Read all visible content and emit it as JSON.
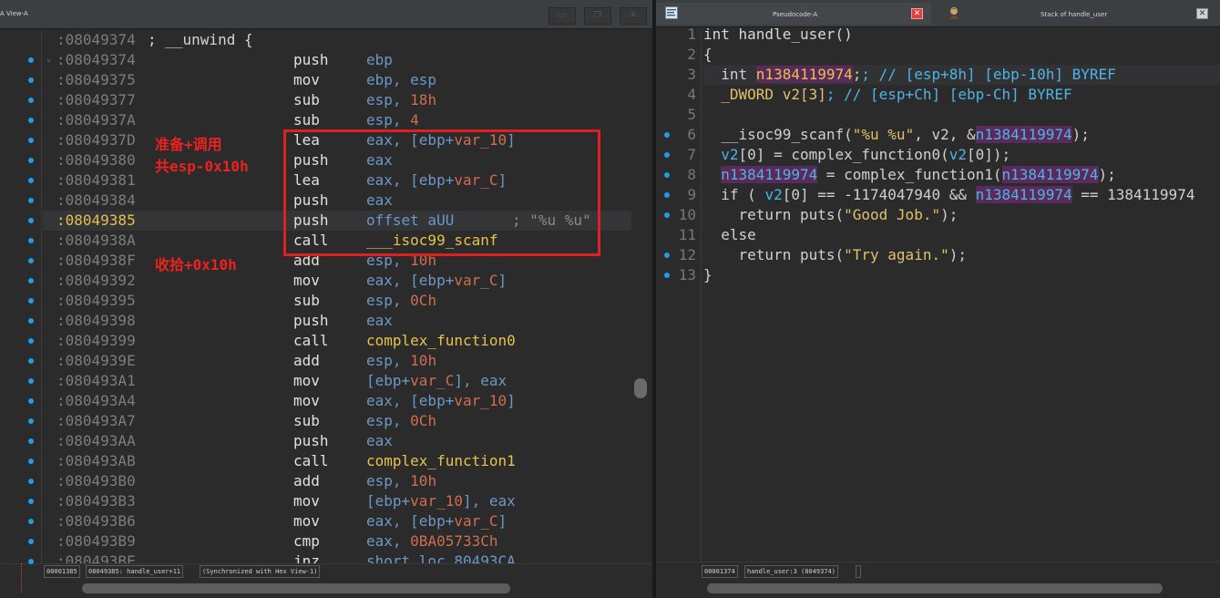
{
  "left": {
    "title": "A View-A",
    "rows": [
      {
        "addr": ":08049374",
        "unwind": "; __unwind {"
      },
      {
        "addr": ":08049374",
        "mnem": "push",
        "ops": "ebp"
      },
      {
        "addr": ":08049375",
        "mnem": "mov",
        "ops": "ebp, esp"
      },
      {
        "addr": ":08049377",
        "mnem": "sub",
        "ops_pre": "esp, ",
        "ops_num": "18h"
      },
      {
        "addr": ":0804937A",
        "mnem": "sub",
        "ops_pre": "esp, ",
        "ops_num": "4"
      },
      {
        "addr": ":0804937D",
        "mnem": "lea",
        "ops_pre": "eax, [ebp+",
        "ops_var": "var_10",
        "ops_post": "]"
      },
      {
        "addr": ":08049380",
        "mnem": "push",
        "ops": "eax"
      },
      {
        "addr": ":08049381",
        "mnem": "lea",
        "ops_pre": "eax, [ebp+",
        "ops_var": "var_C",
        "ops_post": "]"
      },
      {
        "addr": ":08049384",
        "mnem": "push",
        "ops": "eax"
      },
      {
        "addr": ":08049385",
        "mnem": "push",
        "ops": "offset aUU",
        "cmt": "; \"%u %u\"",
        "current": true
      },
      {
        "addr": ":0804938A",
        "mnem": "call",
        "ops_fn": "___isoc99_scanf"
      },
      {
        "addr": ":0804938F",
        "mnem": "add",
        "ops_pre": "esp, ",
        "ops_num": "10h"
      },
      {
        "addr": ":08049392",
        "mnem": "mov",
        "ops_pre": "eax, [ebp+",
        "ops_var": "var_C",
        "ops_post": "]"
      },
      {
        "addr": ":08049395",
        "mnem": "sub",
        "ops_pre": "esp, ",
        "ops_num": "0Ch"
      },
      {
        "addr": ":08049398",
        "mnem": "push",
        "ops": "eax"
      },
      {
        "addr": ":08049399",
        "mnem": "call",
        "ops_fn": "complex_function0"
      },
      {
        "addr": ":0804939E",
        "mnem": "add",
        "ops_pre": "esp, ",
        "ops_num": "10h"
      },
      {
        "addr": ":080493A1",
        "mnem": "mov",
        "ops_pre": "[ebp+",
        "ops_var": "var_C",
        "ops_post": "], eax"
      },
      {
        "addr": ":080493A4",
        "mnem": "mov",
        "ops_pre": "eax, [ebp+",
        "ops_var": "var_10",
        "ops_post": "]"
      },
      {
        "addr": ":080493A7",
        "mnem": "sub",
        "ops_pre": "esp, ",
        "ops_num": "0Ch"
      },
      {
        "addr": ":080493AA",
        "mnem": "push",
        "ops": "eax"
      },
      {
        "addr": ":080493AB",
        "mnem": "call",
        "ops_fn": "complex_function1"
      },
      {
        "addr": ":080493B0",
        "mnem": "add",
        "ops_pre": "esp, ",
        "ops_num": "10h"
      },
      {
        "addr": ":080493B3",
        "mnem": "mov",
        "ops_pre": "[ebp+",
        "ops_var": "var_10",
        "ops_post": "], eax"
      },
      {
        "addr": ":080493B6",
        "mnem": "mov",
        "ops_pre": "eax, [ebp+",
        "ops_var": "var_C",
        "ops_post": "]"
      },
      {
        "addr": ":080493B9",
        "mnem": "cmp",
        "ops_pre": "eax, ",
        "ops_num": "0BA05733Ch"
      },
      {
        "addr": ":080493BE",
        "mnem": "jnz",
        "ops": "short loc_80493CA"
      }
    ],
    "notes": [
      "准备+调用",
      "共esp-0x10h",
      "收拾+0x10h"
    ],
    "status": [
      "00001385",
      "08049385: handle_user+11",
      "(Synchronized with Hex View-1)"
    ]
  },
  "right": {
    "tabs": [
      {
        "label": "Pseudocode-A",
        "icon": "pseudocode-icon"
      },
      {
        "label": "Stack of handle_user",
        "icon": "stack-icon"
      }
    ],
    "status": [
      "00001374",
      "handle_user:3 (8049374)"
    ],
    "lines": [
      {
        "n": "1",
        "bp": false
      },
      {
        "n": "2",
        "bp": false
      },
      {
        "n": "3",
        "bp": false
      },
      {
        "n": "4",
        "bp": false
      },
      {
        "n": "5",
        "bp": false
      },
      {
        "n": "6",
        "bp": true
      },
      {
        "n": "7",
        "bp": true
      },
      {
        "n": "8",
        "bp": true
      },
      {
        "n": "9",
        "bp": true
      },
      {
        "n": "10",
        "bp": true
      },
      {
        "n": "11",
        "bp": false
      },
      {
        "n": "12",
        "bp": true
      },
      {
        "n": "13",
        "bp": true
      }
    ],
    "code": {
      "l1": "int handle_user()",
      "l2": "{",
      "l3_a": "  int ",
      "l3_v": "n1384119974",
      "l3_c": "; // [esp+8h] [ebp-10h] BYREF",
      "l4_a": "  _DWORD v2[3]",
      "l4_c": "; // [esp+Ch] [ebp-Ch] BYREF",
      "l6_a": "  __isoc99_scanf(",
      "l6_s": "\"%u %u\"",
      "l6_b": ", v2, &",
      "l6_v": "n1384119974",
      "l6_c": ");",
      "l7_a": "  v2",
      "l7_b": "[0] = complex_function0(",
      "l7_c": "v2",
      "l7_d": "[0]);",
      "l8_v1": "n1384119974",
      "l8_b": " = complex_function1(",
      "l8_v2": "n1384119974",
      "l8_c": ");",
      "l9_a": "  if ( ",
      "l9_b": "v2",
      "l9_c": "[0] == -1174047940 && ",
      "l9_v": "n1384119974",
      "l9_d": " == 1384119974",
      "l10_a": "    return puts(",
      "l10_s": "\"Good Job.\"",
      "l10_b": ");",
      "l11": "  else",
      "l12_a": "    return puts(",
      "l12_s": "\"Try again.\"",
      "l12_b": ");",
      "l13": "}"
    }
  }
}
